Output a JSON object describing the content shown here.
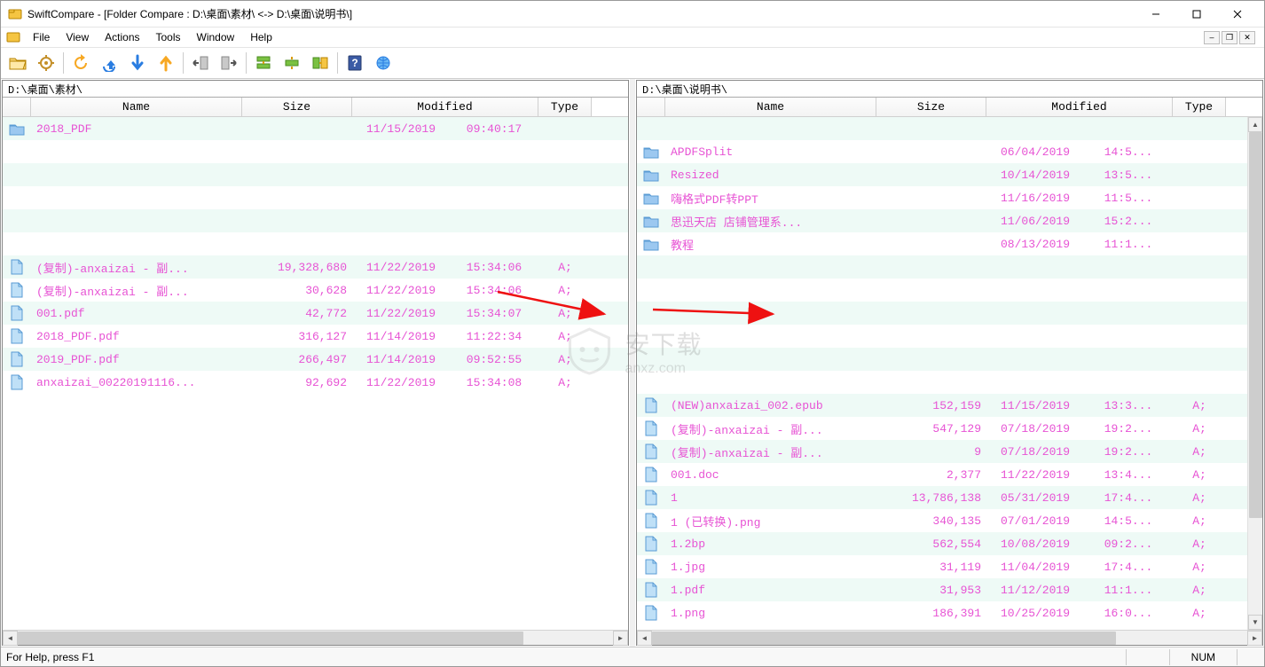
{
  "window": {
    "title": "SwiftCompare - [Folder Compare :  D:\\桌面\\素材\\  <->  D:\\桌面\\说明书\\]"
  },
  "menu": {
    "file": "File",
    "view": "View",
    "actions": "Actions",
    "tools": "Tools",
    "window": "Window",
    "help": "Help"
  },
  "columns": {
    "name": "Name",
    "size": "Size",
    "modified": "Modified",
    "type": "Type"
  },
  "left": {
    "path": "D:\\桌面\\素材\\",
    "rows": [
      {
        "kind": "folder",
        "name": "2018_PDF",
        "size": "",
        "mdate": "11/15/2019",
        "mtime": "09:40:17",
        "type": ""
      },
      {
        "kind": "blank"
      },
      {
        "kind": "blank"
      },
      {
        "kind": "blank"
      },
      {
        "kind": "blank"
      },
      {
        "kind": "blank"
      },
      {
        "kind": "file",
        "name": "(复制)-anxaizai - 副...",
        "size": "19,328,680",
        "mdate": "11/22/2019",
        "mtime": "15:34:06",
        "type": "A;"
      },
      {
        "kind": "file",
        "name": "(复制)-anxaizai - 副...",
        "size": "30,628",
        "mdate": "11/22/2019",
        "mtime": "15:34:06",
        "type": "A;"
      },
      {
        "kind": "file",
        "name": "001.pdf",
        "size": "42,772",
        "mdate": "11/22/2019",
        "mtime": "15:34:07",
        "type": "A;"
      },
      {
        "kind": "file",
        "name": "2018_PDF.pdf",
        "size": "316,127",
        "mdate": "11/14/2019",
        "mtime": "11:22:34",
        "type": "A;"
      },
      {
        "kind": "file",
        "name": "2019_PDF.pdf",
        "size": "266,497",
        "mdate": "11/14/2019",
        "mtime": "09:52:55",
        "type": "A;"
      },
      {
        "kind": "file",
        "name": "anxaizai_00220191116...",
        "size": "92,692",
        "mdate": "11/22/2019",
        "mtime": "15:34:08",
        "type": "A;"
      }
    ]
  },
  "right": {
    "path": "D:\\桌面\\说明书\\",
    "rows": [
      {
        "kind": "blank"
      },
      {
        "kind": "folder",
        "name": "APDFSplit",
        "size": "",
        "mdate": "06/04/2019",
        "mtime": "14:5...",
        "type": ""
      },
      {
        "kind": "folder",
        "name": "Resized",
        "size": "",
        "mdate": "10/14/2019",
        "mtime": "13:5...",
        "type": ""
      },
      {
        "kind": "folder",
        "name": "嗨格式PDF转PPT",
        "size": "",
        "mdate": "11/16/2019",
        "mtime": "11:5...",
        "type": ""
      },
      {
        "kind": "folder",
        "name": "思迅天店 店铺管理系...",
        "size": "",
        "mdate": "11/06/2019",
        "mtime": "15:2...",
        "type": ""
      },
      {
        "kind": "folder",
        "name": "教程",
        "size": "",
        "mdate": "08/13/2019",
        "mtime": "11:1...",
        "type": ""
      },
      {
        "kind": "blank"
      },
      {
        "kind": "blank"
      },
      {
        "kind": "blank"
      },
      {
        "kind": "blank"
      },
      {
        "kind": "blank"
      },
      {
        "kind": "blank"
      },
      {
        "kind": "file",
        "name": "(NEW)anxaizai_002.epub",
        "size": "152,159",
        "mdate": "11/15/2019",
        "mtime": "13:3...",
        "type": "A;"
      },
      {
        "kind": "file",
        "name": "(复制)-anxaizai - 副...",
        "size": "547,129",
        "mdate": "07/18/2019",
        "mtime": "19:2...",
        "type": "A;"
      },
      {
        "kind": "file",
        "name": "(复制)-anxaizai - 副...",
        "size": "9",
        "mdate": "07/18/2019",
        "mtime": "19:2...",
        "type": "A;"
      },
      {
        "kind": "file",
        "name": "001.doc",
        "size": "2,377",
        "mdate": "11/22/2019",
        "mtime": "13:4...",
        "type": "A;"
      },
      {
        "kind": "file",
        "name": "1",
        "size": "13,786,138",
        "mdate": "05/31/2019",
        "mtime": "17:4...",
        "type": "A;"
      },
      {
        "kind": "file",
        "name": "1 (已转换).png",
        "size": "340,135",
        "mdate": "07/01/2019",
        "mtime": "14:5...",
        "type": "A;"
      },
      {
        "kind": "file",
        "name": "1.2bp",
        "size": "562,554",
        "mdate": "10/08/2019",
        "mtime": "09:2...",
        "type": "A;"
      },
      {
        "kind": "file",
        "name": "1.jpg",
        "size": "31,119",
        "mdate": "11/04/2019",
        "mtime": "17:4...",
        "type": "A;"
      },
      {
        "kind": "file",
        "name": "1.pdf",
        "size": "31,953",
        "mdate": "11/12/2019",
        "mtime": "11:1...",
        "type": "A;"
      },
      {
        "kind": "file",
        "name": "1.png",
        "size": "186,391",
        "mdate": "10/25/2019",
        "mtime": "16:0...",
        "type": "A;"
      }
    ]
  },
  "status": {
    "help": "For Help, press F1",
    "num": "NUM"
  },
  "watermark": {
    "brand": "安下载",
    "url": "anxz.com"
  }
}
